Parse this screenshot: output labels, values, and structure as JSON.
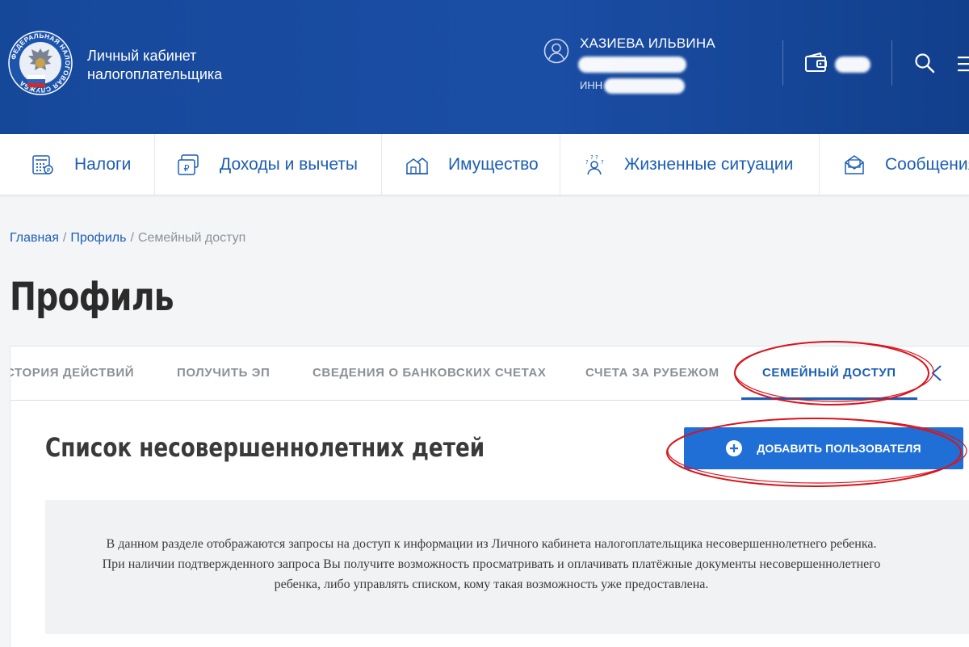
{
  "colors": {
    "header_bg": "#16489a",
    "accent": "#1b5eb5",
    "button_bg": "#1f6fd6",
    "annotation": "#d9141c",
    "info_bg": "#f1f2f4"
  },
  "header": {
    "logo_icon": "fns-emblem-icon",
    "logo_ring_text": "ФЕДЕРАЛЬНАЯ НАЛОГОВАЯ СЛУЖБА",
    "brand_line1": "Личный кабинет",
    "brand_line2": "налогоплательщика",
    "user_icon": "user-circle-icon",
    "user_name": "ХАЗИЕВА ИЛЬВИНА",
    "inn_label": "ИНН",
    "wallet_icon": "wallet-icon",
    "search_icon": "search-icon",
    "menu_icon": "menu-icon"
  },
  "nav": {
    "items": [
      {
        "label": "Налоги",
        "icon": "tax-calculator-icon"
      },
      {
        "label": "Доходы и вычеты",
        "icon": "income-ruble-icon"
      },
      {
        "label": "Имущество",
        "icon": "property-icon"
      },
      {
        "label": "Жизненные ситуации",
        "icon": "life-situations-icon"
      },
      {
        "label": "Сообщения",
        "icon": "messages-icon"
      }
    ]
  },
  "breadcrumb": {
    "home": "Главная",
    "profile": "Профиль",
    "current": "Семейный доступ",
    "separator": "/"
  },
  "page": {
    "title": "Профиль"
  },
  "tabs": {
    "items": [
      "СТОРИЯ ДЕЙСТВИЙ",
      "ПОЛУЧИТЬ ЭП",
      "СВЕДЕНИЯ О БАНКОВСКИХ СЧЕТАХ",
      "СЧЕТА ЗА РУБЕЖОМ",
      "СЕМЕЙНЫЙ ДОСТУП"
    ],
    "active": "СЕМЕЙНЫЙ ДОСТУП",
    "scroll_icon": "chevron-left-icon"
  },
  "section": {
    "title": "Список несовершеннолетних детей",
    "add_button_label": "ДОБАВИТЬ ПОЛЬЗОВАТЕЛЯ",
    "add_button_icon": "plus-circle-icon"
  },
  "info": {
    "line1": "В данном разделе отображаются запросы на доступ к информации из Личного кабинета налогоплательщика несовершеннолетнего ребенка.",
    "line2": "При наличии подтвержденного запроса Вы получите возможность просматривать и оплачивать платёжные документы несовершеннолетнего",
    "line3": "ребенка, либо управлять списком, кому такая возможность уже предоставлена."
  }
}
